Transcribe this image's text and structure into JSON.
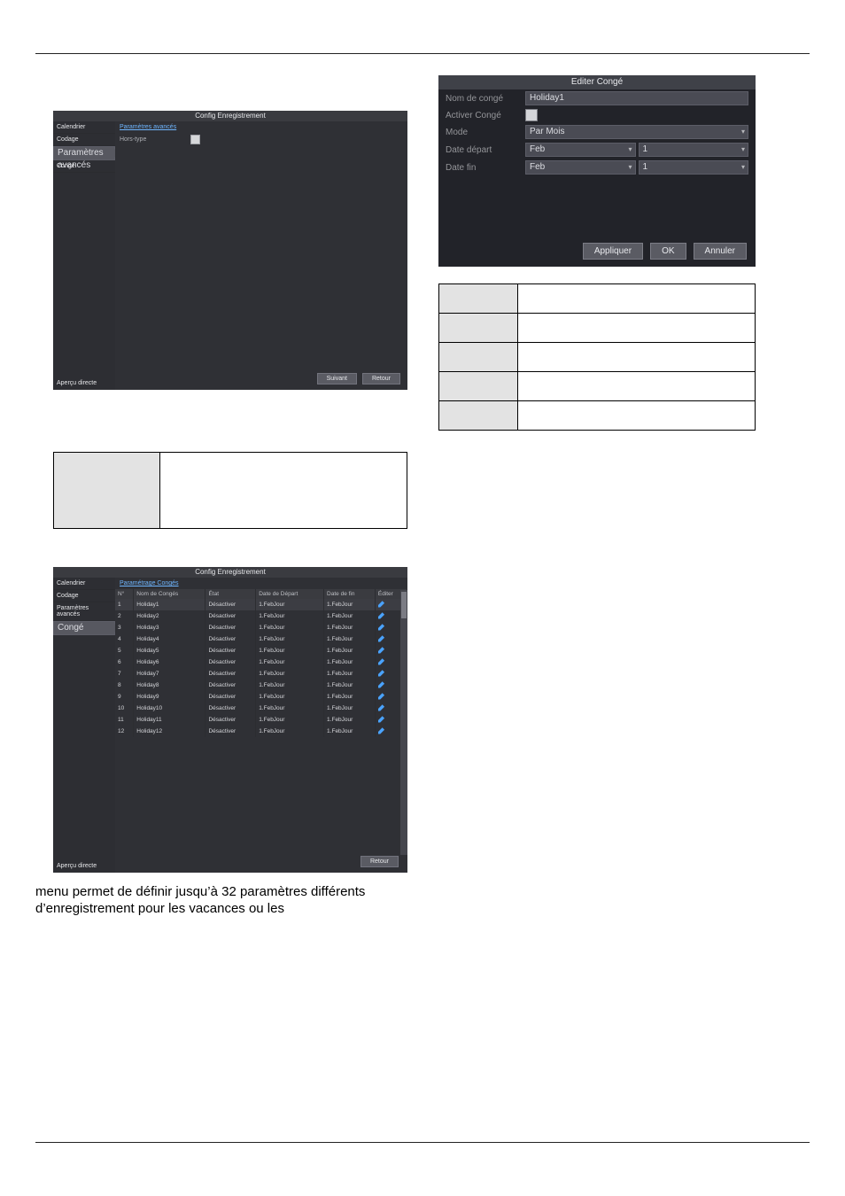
{
  "panel1": {
    "title": "Config Enregistrement",
    "sidebar": [
      "Calendrier",
      "Codage",
      "Paramètres avancés",
      "Congé"
    ],
    "sidebar_selected_index": 2,
    "tab": "Paramètres avancés",
    "row_label": "Hors-type",
    "apercu": "Aperçu directe",
    "buttons": {
      "ok": "Suivant",
      "back": "Retour"
    }
  },
  "panel2": {
    "title": "Editer Congé",
    "labels": {
      "name": "Nom de congé",
      "enable": "Activer Congé",
      "mode": "Mode",
      "start": "Date départ",
      "end": "Date fin"
    },
    "values": {
      "name": "Holiday1",
      "mode": "Par Mois",
      "start_month": "Feb",
      "start_day": "1",
      "end_month": "Feb",
      "end_day": "1"
    },
    "buttons": {
      "apply": "Appliquer",
      "ok": "OK",
      "cancel": "Annuler"
    }
  },
  "panel3": {
    "title": "Config Enregistrement",
    "sidebar": [
      "Calendrier",
      "Codage",
      "Paramètres avancés",
      "Congé"
    ],
    "sidebar_selected_index": 3,
    "tab": "Paramétrage Congés",
    "headers": [
      "N°",
      "Nom de Congés",
      "État",
      "Date de Départ",
      "Date de fin",
      "Éditer"
    ],
    "rows": [
      {
        "n": "1",
        "name": "Holiday1",
        "etat": "Désactiver",
        "start": "1.FebJour",
        "end": "1.FebJour"
      },
      {
        "n": "2",
        "name": "Holiday2",
        "etat": "Désactiver",
        "start": "1.FebJour",
        "end": "1.FebJour"
      },
      {
        "n": "3",
        "name": "Holiday3",
        "etat": "Désactiver",
        "start": "1.FebJour",
        "end": "1.FebJour"
      },
      {
        "n": "4",
        "name": "Holiday4",
        "etat": "Désactiver",
        "start": "1.FebJour",
        "end": "1.FebJour"
      },
      {
        "n": "5",
        "name": "Holiday5",
        "etat": "Désactiver",
        "start": "1.FebJour",
        "end": "1.FebJour"
      },
      {
        "n": "6",
        "name": "Holiday6",
        "etat": "Désactiver",
        "start": "1.FebJour",
        "end": "1.FebJour"
      },
      {
        "n": "7",
        "name": "Holiday7",
        "etat": "Désactiver",
        "start": "1.FebJour",
        "end": "1.FebJour"
      },
      {
        "n": "8",
        "name": "Holiday8",
        "etat": "Désactiver",
        "start": "1.FebJour",
        "end": "1.FebJour"
      },
      {
        "n": "9",
        "name": "Holiday9",
        "etat": "Désactiver",
        "start": "1.FebJour",
        "end": "1.FebJour"
      },
      {
        "n": "10",
        "name": "Holiday10",
        "etat": "Désactiver",
        "start": "1.FebJour",
        "end": "1.FebJour"
      },
      {
        "n": "11",
        "name": "Holiday11",
        "etat": "Désactiver",
        "start": "1.FebJour",
        "end": "1.FebJour"
      },
      {
        "n": "12",
        "name": "Holiday12",
        "etat": "Désactiver",
        "start": "1.FebJour",
        "end": "1.FebJour"
      }
    ],
    "apercu": "Aperçu directe",
    "buttons": {
      "back": "Retour"
    }
  },
  "doc_text": "menu permet de définir jusqu’à 32 paramètres différents d’enregistrement pour les vacances ou les"
}
